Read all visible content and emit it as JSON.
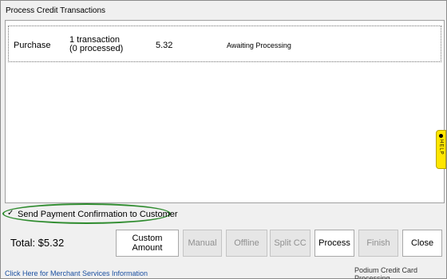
{
  "window": {
    "title": "Process Credit Transactions"
  },
  "transactions": [
    {
      "type": "Purchase",
      "count_line1": "1 transaction",
      "count_line2": "(0 processed)",
      "amount": "5.32",
      "status": "Awaiting Processing"
    }
  ],
  "help_tab": {
    "label": "HELP",
    "icon": "help-dot-icon"
  },
  "confirmation": {
    "checked": true,
    "label": "Send Payment Confirmation to Customer",
    "highlight_color": "#2e8b2e"
  },
  "total": {
    "label": "Total: $5.32"
  },
  "buttons": {
    "custom_amount": "Custom Amount",
    "manual": "Manual",
    "offline": "Offline",
    "split_cc": "Split CC",
    "process": "Process",
    "finish": "Finish",
    "close": "Close"
  },
  "footer": {
    "merchant_link": "Click Here for Merchant Services Information",
    "provider": "Podium Credit Card Processing"
  }
}
